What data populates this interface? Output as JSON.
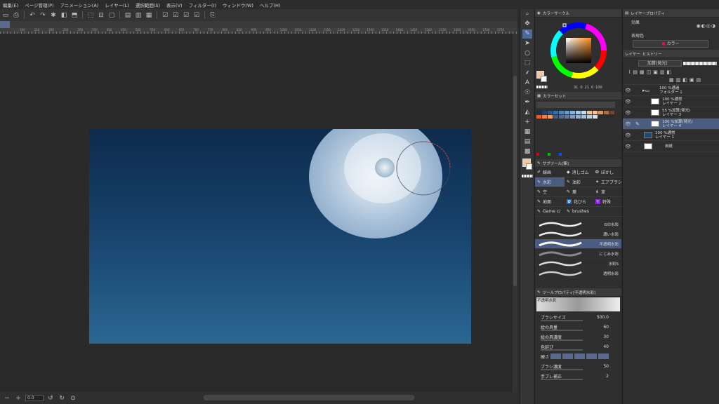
{
  "menu": [
    "編集(E)",
    "ページ管理(P)",
    "アニメーション(A)",
    "レイヤー(L)",
    "選択範囲(S)",
    "表示(V)",
    "フィルター(I)",
    "ウィンドウ(W)",
    "ヘルプ(H)"
  ],
  "ruler_marks": [
    "100",
    "150",
    "200",
    "250",
    "300",
    "350",
    "400",
    "450",
    "500",
    "550",
    "600",
    "650",
    "700",
    "750",
    "800",
    "850",
    "900",
    "950",
    "1000",
    "1050",
    "1100",
    "1150",
    "1200",
    "1250",
    "1300",
    "1350",
    "1400",
    "1450",
    "1500",
    "1550",
    "1600",
    "1650",
    "1700",
    "1750"
  ],
  "status": {
    "zoom": "0.0"
  },
  "color_circle": {
    "title": "カラーサークル",
    "h": "31",
    "s": "0",
    "v": "21",
    "v2": "0",
    "b": "100",
    "main_color": "#f3c79b",
    "sub_color": "#ffffff"
  },
  "color_set": {
    "title": "カラーセット"
  },
  "subtool": {
    "title": "サブツール[筆]",
    "items": [
      [
        "線画",
        "消しゴム",
        "ぼかし"
      ],
      [
        "水彩",
        "油彩",
        "エアブラシ"
      ],
      [
        "空",
        "葉",
        "草"
      ],
      [
        "地面",
        "花びら",
        "特殊"
      ],
      [
        "Game c/",
        "brushes",
        ""
      ]
    ],
    "brushes": [
      "Gの水彩",
      "濃い水彩",
      "不透明水彩",
      "にじみ水彩",
      "水彩S",
      "透明水彩"
    ]
  },
  "tool_property": {
    "title": "ツールプロパティ[不透明水彩]",
    "brush_name": "不透明水彩",
    "props": [
      {
        "label": "ブラシサイズ",
        "value": "500.0"
      },
      {
        "label": "絵の具量",
        "value": "60"
      },
      {
        "label": "絵の具濃度",
        "value": "30"
      },
      {
        "label": "色延び",
        "value": "40"
      },
      {
        "label": "硬さ",
        "value": ""
      },
      {
        "label": "ブラシ濃度",
        "value": "50"
      },
      {
        "label": "手ブレ補正",
        "value": "2"
      }
    ]
  },
  "layer_property": {
    "title": "レイヤープロパティ",
    "effect_label": "効果",
    "expression_label": "表現色",
    "expression_value": "カラー"
  },
  "layers_panel": {
    "tab_layer": "レイヤー",
    "tab_history": "ヒストリー",
    "blend_mode": "加算(発光)",
    "layers": [
      {
        "line1": "100 %通過",
        "line2": "フォルダー 1",
        "selected": false,
        "type": "folder"
      },
      {
        "line1": "100 %通常",
        "line2": "レイヤー 2",
        "selected": false,
        "type": "layer"
      },
      {
        "line1": "55 %加算(発光)",
        "line2": "レイヤー 3",
        "selected": false,
        "type": "layer"
      },
      {
        "line1": "100 %加算(発光)",
        "line2": "レイヤー 4",
        "selected": true,
        "type": "layer"
      },
      {
        "line1": "100 %通常",
        "line2": "レイヤー 1",
        "selected": false,
        "type": "layer"
      },
      {
        "line1": "用紙",
        "line2": "",
        "selected": false,
        "type": "paper"
      }
    ]
  }
}
